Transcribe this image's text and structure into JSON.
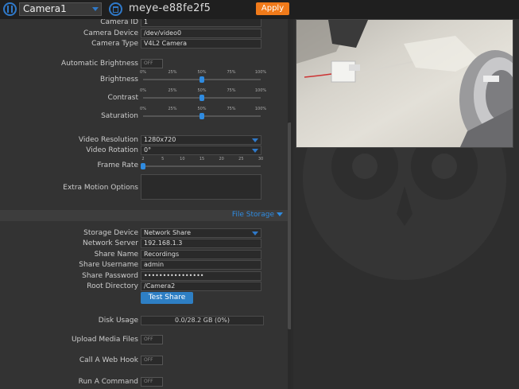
{
  "topbar": {
    "camera_selected": "Camera1",
    "hostname": "meye-e88fe2f5",
    "apply_label": "Apply"
  },
  "camera": {
    "id_label": "Camera ID",
    "id_value": "1",
    "device_label": "Camera Device",
    "device_value": "/dev/video0",
    "type_label": "Camera Type",
    "type_value": "V4L2 Camera"
  },
  "image": {
    "auto_brightness_label": "Automatic Brightness",
    "auto_brightness_state": "OFF",
    "brightness_label": "Brightness",
    "brightness_value": 50,
    "contrast_label": "Contrast",
    "contrast_value": 50,
    "saturation_label": "Saturation",
    "saturation_value": 50,
    "percent_ticks": [
      "0%",
      "25%",
      "50%",
      "75%",
      "100%"
    ]
  },
  "video": {
    "resolution_label": "Video Resolution",
    "resolution_value": "1280x720",
    "rotation_label": "Video Rotation",
    "rotation_value": "0°",
    "framerate_label": "Frame Rate",
    "framerate_value": 2,
    "framerate_ticks": [
      "2",
      "5",
      "10",
      "15",
      "20",
      "25",
      "30"
    ],
    "extra_motion_label": "Extra Motion Options"
  },
  "storage": {
    "section_title": "File Storage",
    "device_label": "Storage Device",
    "device_value": "Network Share",
    "server_label": "Network Server",
    "server_value": "192.168.1.3",
    "share_name_label": "Share Name",
    "share_name_value": "Recordings",
    "username_label": "Share Username",
    "username_value": "admin",
    "password_label": "Share Password",
    "password_value": "••••••••••••••••",
    "root_label": "Root Directory",
    "root_value": "/Camera2",
    "test_share_label": "Test Share",
    "disk_usage_label": "Disk Usage",
    "disk_usage_value": "0.0/28.2 GB (0%)"
  },
  "actions": {
    "upload_label": "Upload Media Files",
    "upload_state": "OFF",
    "webhook_label": "Call A Web Hook",
    "webhook_state": "OFF",
    "command_label": "Run A Command",
    "command_state": "OFF"
  },
  "colors": {
    "accent": "#2f8be0",
    "apply": "#f07a1a",
    "panel": "#333333",
    "background": "#2b2b2b"
  },
  "icons": {
    "menu": "pause-circle-icon",
    "delete": "trash-icon"
  }
}
